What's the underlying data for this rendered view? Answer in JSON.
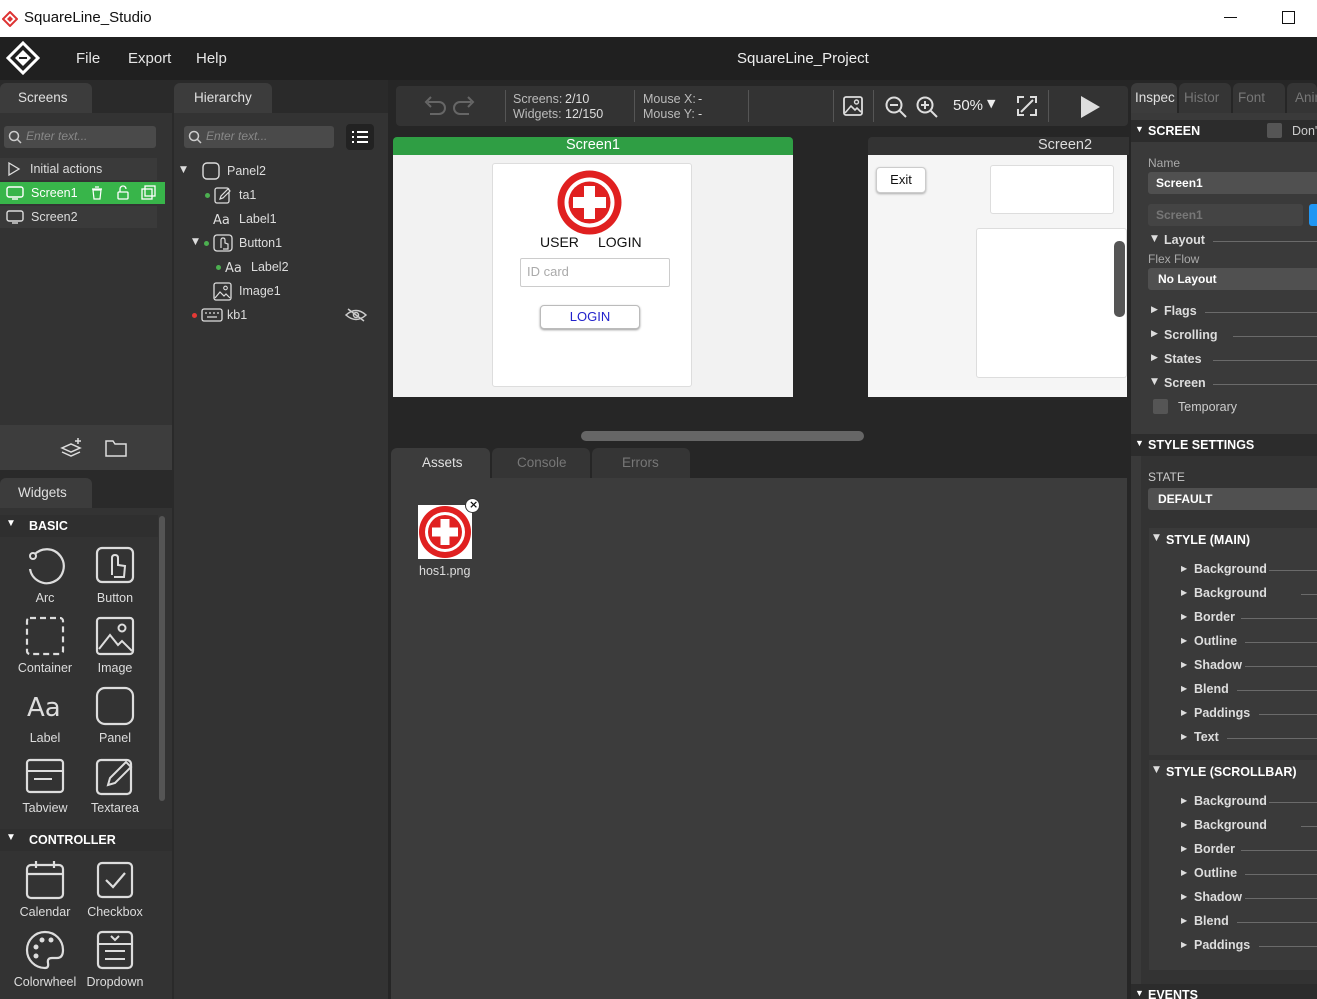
{
  "window": {
    "title": "SquareLine_Studio"
  },
  "menubar": {
    "items": [
      "File",
      "Export",
      "Help"
    ],
    "project_title": "SquareLine_Project"
  },
  "screens_panel": {
    "tab": "Screens",
    "search_placeholder": "Enter text...",
    "items": [
      "Initial actions",
      "Screen1",
      "Screen2"
    ]
  },
  "hierarchy_panel": {
    "tab": "Hierarchy",
    "search_placeholder": "Enter text...",
    "items": [
      "Panel2",
      "ta1",
      "Label1",
      "Button1",
      "Label2",
      "Image1",
      "kb1"
    ]
  },
  "toolbar": {
    "screens_label": "Screens:",
    "screens_value": "2/10",
    "widgets_label": "Widgets:",
    "widgets_value": "12/150",
    "mouse_x_label": "Mouse X:",
    "mouse_x_value": "-",
    "mouse_y_label": "Mouse Y:",
    "mouse_y_value": "-",
    "zoom": "50%"
  },
  "canvas": {
    "screen1": {
      "title": "Screen1",
      "heading_left": "USER",
      "heading_right": "LOGIN",
      "input_placeholder": "ID card",
      "button_label": "LOGIN"
    },
    "screen2": {
      "title": "Screen2",
      "exit_label": "Exit"
    }
  },
  "bottom_panel": {
    "tabs": [
      "Assets",
      "Console",
      "Errors"
    ],
    "asset_name": "hos1.png"
  },
  "widgets_panel": {
    "tab": "Widgets",
    "basic_header": "BASIC",
    "basic": [
      "Arc",
      "Button",
      "Container",
      "Image",
      "Label",
      "Panel",
      "Tabview",
      "Textarea"
    ],
    "controller_header": "CONTROLLER",
    "controller": [
      "Calendar",
      "Checkbox",
      "Colorwheel",
      "Dropdown"
    ]
  },
  "inspector": {
    "tabs": [
      "Inspec",
      "Histor",
      "Font",
      "Anima"
    ],
    "screen_header": "SCREEN",
    "dont_label": "Don'",
    "name_label": "Name",
    "name_value": "Screen1",
    "name_placeholder": "Screen1",
    "layout_label": "Layout",
    "flex_flow_label": "Flex Flow",
    "flex_flow_value": "No Layout",
    "sections": [
      "Flags",
      "Scrolling",
      "States",
      "Screen"
    ],
    "temporary_label": "Temporary",
    "style_settings": "STYLE SETTINGS",
    "state_label": "STATE",
    "state_value": "DEFAULT",
    "style_main": "STYLE (MAIN)",
    "main_items": [
      "Background",
      "Background",
      "Border",
      "Outline",
      "Shadow",
      "Blend",
      "Paddings",
      "Text"
    ],
    "style_scrollbar": "STYLE (SCROLLBAR)",
    "scroll_items": [
      "Background",
      "Background",
      "Border",
      "Outline",
      "Shadow",
      "Blend",
      "Paddings"
    ],
    "events": "EVENTS"
  },
  "colors": {
    "accent_green": "#2f9e44",
    "selection_green": "#38b54a",
    "red_logo": "#e02020",
    "login_blue": "#2222cc"
  }
}
